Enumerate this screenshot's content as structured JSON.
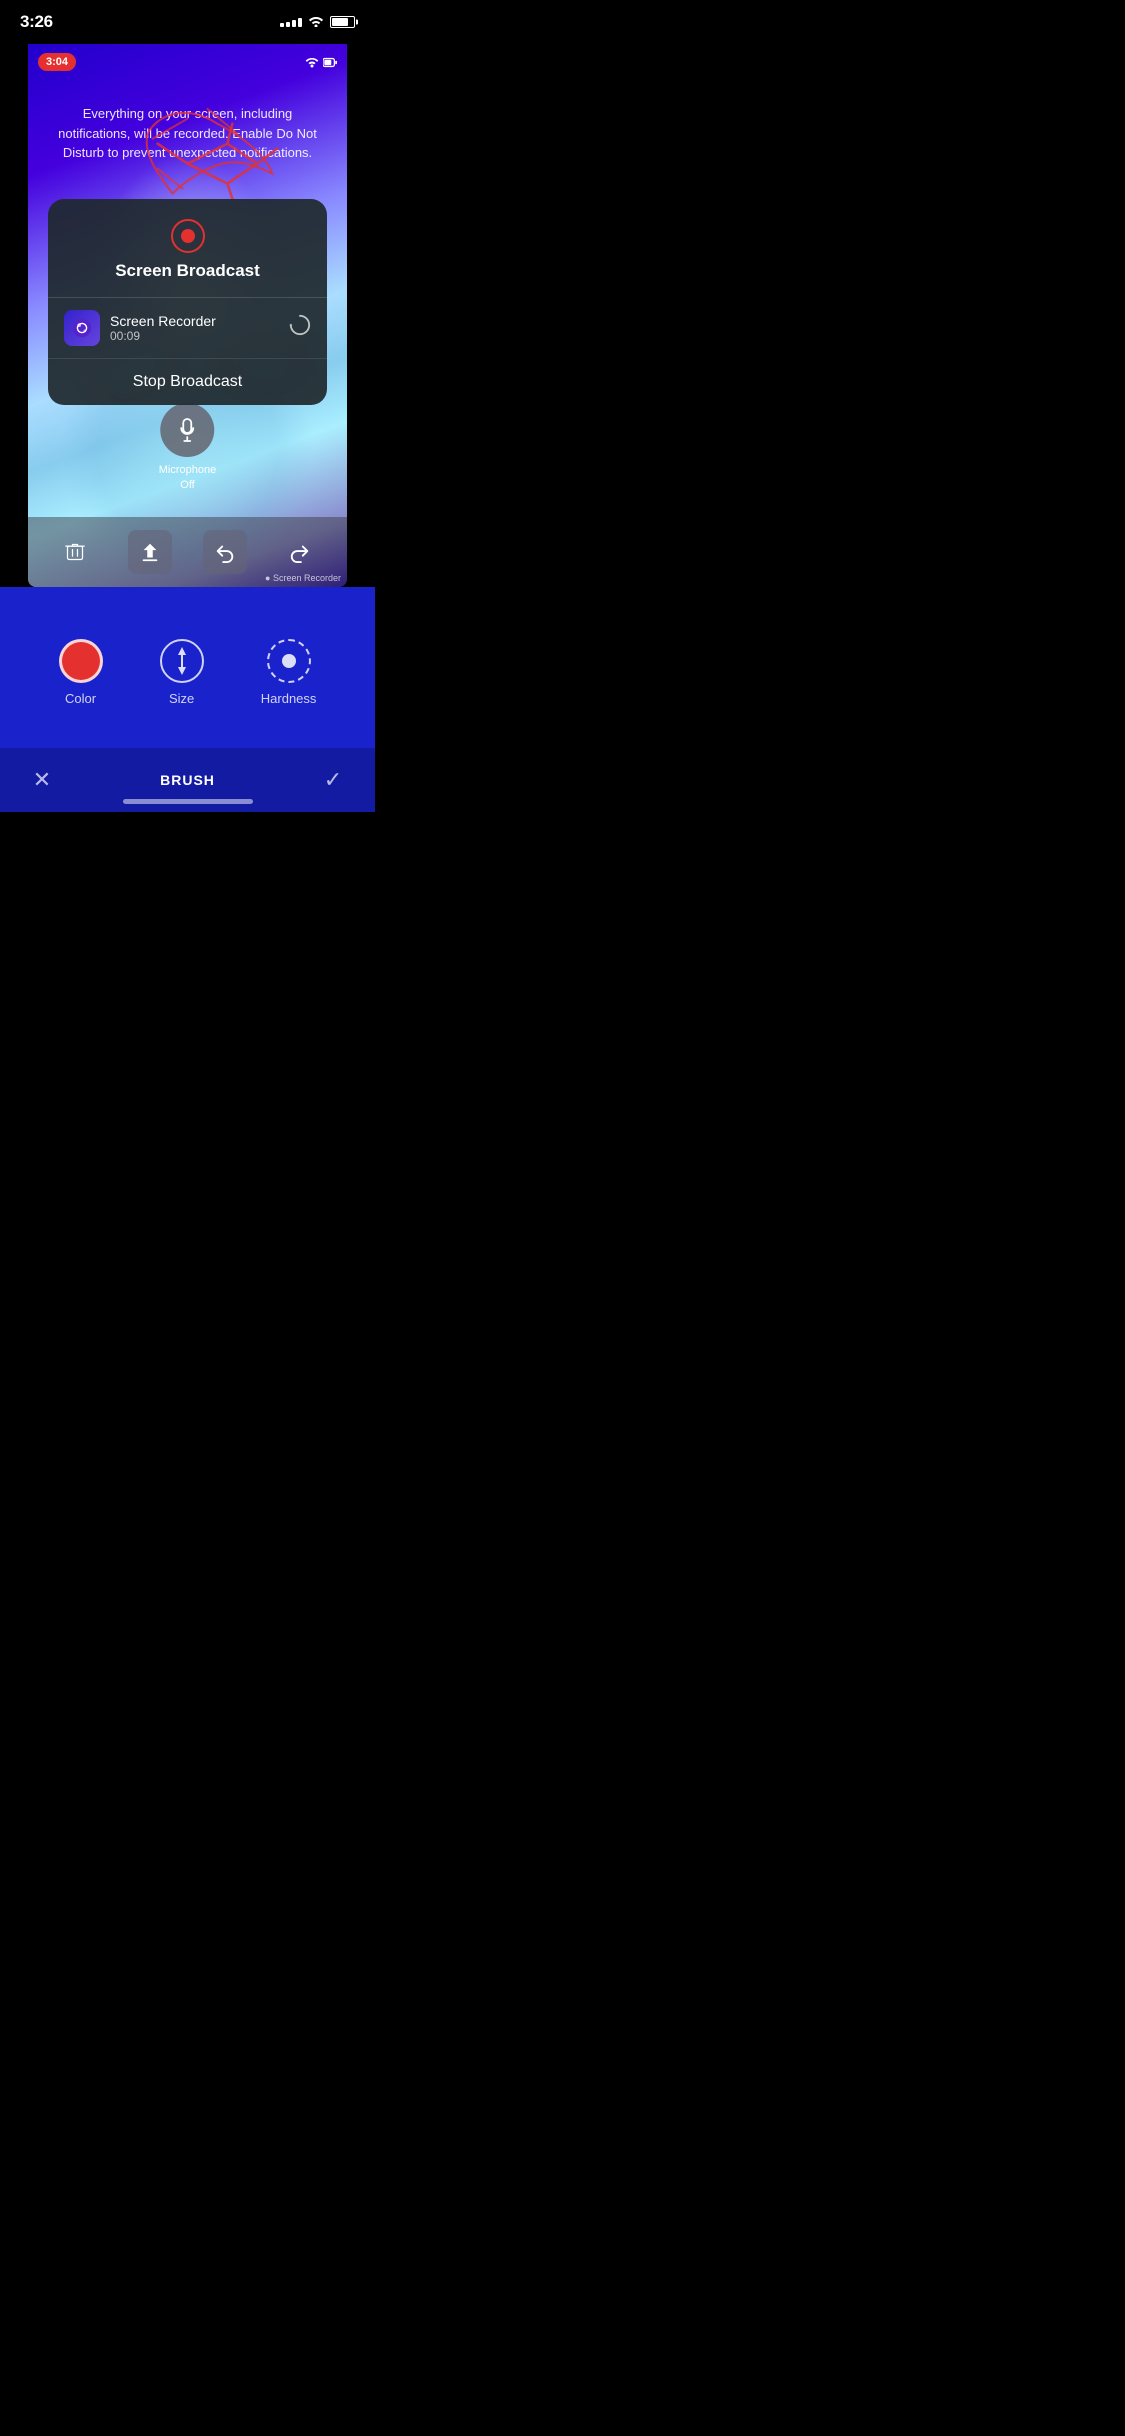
{
  "statusBar": {
    "time": "3:26",
    "battery": "75"
  },
  "appScreen": {
    "recordingTimer": "3:04",
    "warningText": "Everything on your screen, including notifications, will be recorded. Enable Do Not Disturb to prevent unexpected notifications.",
    "broadcastModal": {
      "title": "Screen Broadcast",
      "recorderName": "Screen Recorder",
      "recorderTime": "00:09",
      "stopBroadcastLabel": "Stop Broadcast"
    },
    "microphoneButton": {
      "label": "Microphone\nOff"
    },
    "toolbar": {
      "deleteLabel": "🗑",
      "uploadLabel": "↑",
      "undoLabel": "↩",
      "redoLabel": "↪",
      "watermark": "● Screen Recorder"
    }
  },
  "bottomToolbar": {
    "toolOptions": [
      {
        "id": "color",
        "label": "Color"
      },
      {
        "id": "size",
        "label": "Size"
      },
      {
        "id": "hardness",
        "label": "Hardness"
      }
    ],
    "brushBar": {
      "cancelLabel": "✕",
      "title": "BRUSH",
      "confirmLabel": "✓"
    }
  }
}
